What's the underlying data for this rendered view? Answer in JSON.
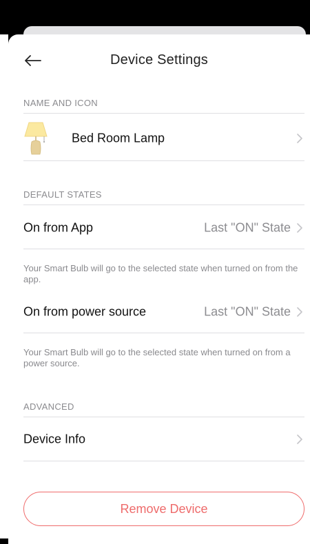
{
  "header": {
    "title": "Device Settings",
    "back_icon": "arrow-left-icon"
  },
  "sections": {
    "name_and_icon": {
      "label": "NAME AND ICON",
      "device_name": "Bed Room Lamp",
      "device_icon": "table-lamp-icon"
    },
    "default_states": {
      "label": "DEFAULT STATES",
      "on_from_app": {
        "label": "On from App",
        "value": "Last \"ON\" State",
        "help": "Your Smart Bulb will go to the selected state when turned on from the app."
      },
      "on_from_power": {
        "label": "On from power source",
        "value": "Last \"ON\" State",
        "help": "Your Smart Bulb will go to the selected state when turned on from a power source."
      }
    },
    "advanced": {
      "label": "ADVANCED",
      "device_info": {
        "label": "Device Info"
      }
    }
  },
  "actions": {
    "remove_label": "Remove Device"
  },
  "colors": {
    "accent_danger": "#ee6b6b",
    "secondary_text": "#8a8a8e",
    "divider": "#dedee2"
  }
}
